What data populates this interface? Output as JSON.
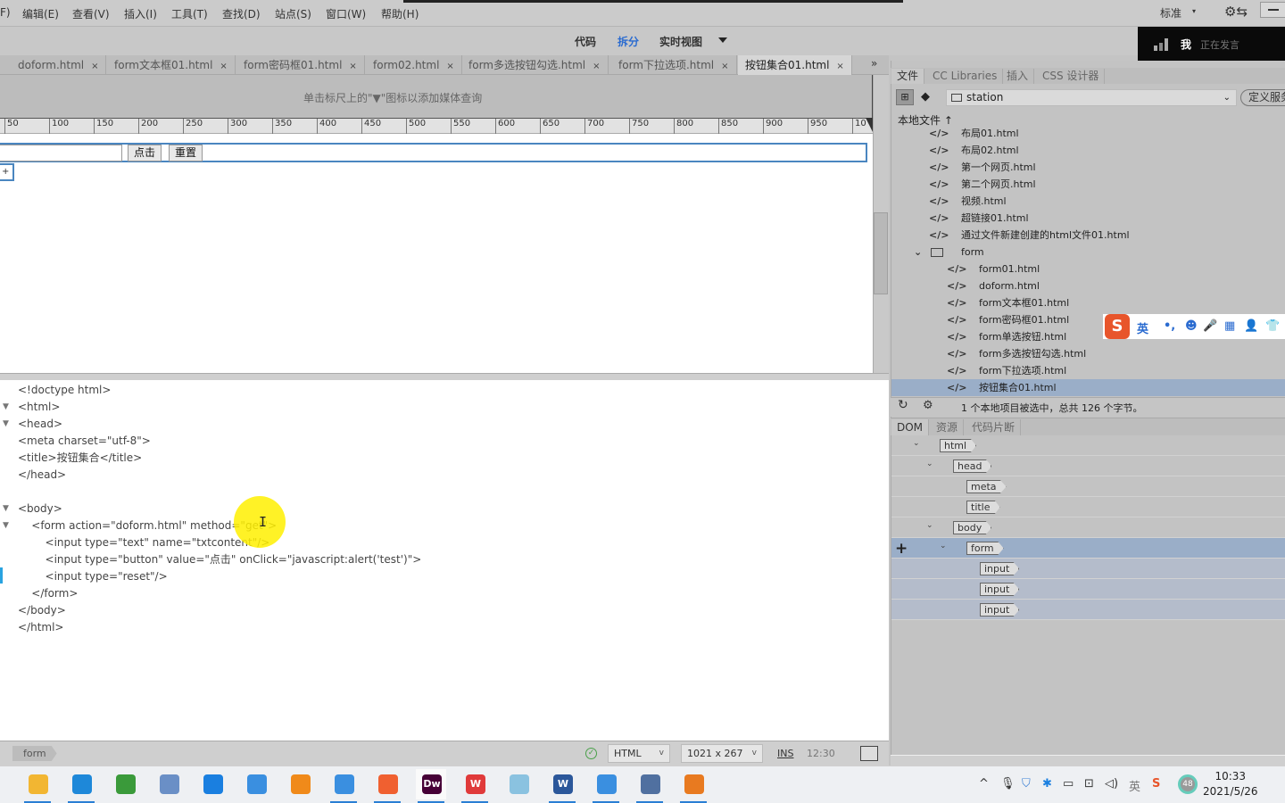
{
  "menu": {
    "items": [
      "F)",
      "编辑(E)",
      "查看(V)",
      "插入(I)",
      "工具(T)",
      "查找(D)",
      "站点(S)",
      "窗口(W)",
      "帮助(H)"
    ],
    "workspace": "标准",
    "workspace_arrow": "▾",
    "settings_icon": "⚙⇆"
  },
  "viewbar": {
    "code": "代码",
    "split": "拆分",
    "live": "实时视图",
    "active": "split"
  },
  "speaking": {
    "me": "我",
    "status": "正在发言"
  },
  "tabs": [
    {
      "label": "doform.html",
      "active": false
    },
    {
      "label": "form文本框01.html",
      "active": false
    },
    {
      "label": "form密码框01.html",
      "active": false
    },
    {
      "label": "form02.html",
      "active": false
    },
    {
      "label": "form多选按钮勾选.html",
      "active": false
    },
    {
      "label": "form下拉选项.html",
      "active": false
    },
    {
      "label": "按钮集合01.html",
      "active": true
    }
  ],
  "tab_close": "×",
  "tab_overflow": "»",
  "design": {
    "media_query_hint": "单击标尺上的\"▼\"图标以添加媒体查询",
    "ruler_ticks": [
      "50",
      "100",
      "150",
      "200",
      "250",
      "300",
      "350",
      "400",
      "450",
      "500",
      "550",
      "600",
      "650",
      "700",
      "750",
      "800",
      "850",
      "900",
      "950",
      "10"
    ],
    "button_label": "点击",
    "reset_label": "重置",
    "plus": "+"
  },
  "code_lines": [
    {
      "text": "<!doctype html>",
      "fold": false
    },
    {
      "text": "<html>",
      "fold": true
    },
    {
      "text": "<head>",
      "fold": true
    },
    {
      "text": "<meta charset=\"utf-8\">",
      "fold": false
    },
    {
      "text": "<title>按钮集合</title>",
      "fold": false
    },
    {
      "text": "</head>",
      "fold": false
    },
    {
      "text": "",
      "fold": false
    },
    {
      "text": "<body>",
      "fold": true
    },
    {
      "text": "    <form action=\"doform.html\" method=\"get\">",
      "fold": true
    },
    {
      "text": "        <input type=\"text\" name=\"txtcontent\"/>",
      "fold": false
    },
    {
      "text": "        <input type=\"button\" value=\"点击\" onClick=\"javascript:alert('test')\">",
      "fold": false
    },
    {
      "text": "        <input type=\"reset\"/>",
      "fold": false
    },
    {
      "text": "    </form>",
      "fold": false
    },
    {
      "text": "</body>",
      "fold": false
    },
    {
      "text": "</html>",
      "fold": false
    }
  ],
  "statusbar": {
    "breadcrumb": "form",
    "ok_icon": "✓",
    "doc_type": "HTML",
    "window_size": "1021 x 267",
    "insert_mode": "INS",
    "cursor_pos": "12:30"
  },
  "files_panel": {
    "tabs": [
      "文件",
      "CC Libraries",
      "插入",
      "CSS 设计器"
    ],
    "site": "station",
    "define_server": "定义服务",
    "local_files": "本地文件 ↑",
    "items": [
      {
        "name": "布局01.html",
        "type": "file",
        "level": 1
      },
      {
        "name": "布局02.html",
        "type": "file",
        "level": 1
      },
      {
        "name": "第一个网页.html",
        "type": "file",
        "level": 1
      },
      {
        "name": "第二个网页.html",
        "type": "file",
        "level": 1
      },
      {
        "name": "视频.html",
        "type": "file",
        "level": 1
      },
      {
        "name": "超链接01.html",
        "type": "file",
        "level": 1
      },
      {
        "name": "通过文件新建创建的html文件01.html",
        "type": "file",
        "level": 1
      },
      {
        "name": "form",
        "type": "folder",
        "level": 1
      },
      {
        "name": "form01.html",
        "type": "file",
        "level": 2
      },
      {
        "name": "doform.html",
        "type": "file",
        "level": 2
      },
      {
        "name": "form文本框01.html",
        "type": "file",
        "level": 2
      },
      {
        "name": "form密码框01.html",
        "type": "file",
        "level": 2
      },
      {
        "name": "form单选按钮.html",
        "type": "file",
        "level": 2
      },
      {
        "name": "form多选按钮勾选.html",
        "type": "file",
        "level": 2
      },
      {
        "name": "form下拉选项.html",
        "type": "file",
        "level": 2
      },
      {
        "name": "按钮集合01.html",
        "type": "file",
        "level": 2,
        "selected": true
      }
    ],
    "status": "1 个本地项目被选中，总共 126 个字节。"
  },
  "ime": {
    "logo": "S",
    "lang": "英",
    "punct": "•,",
    "emoji": "☻",
    "mic": "🎤",
    "keyboard": "▦",
    "user": "👤",
    "skin": "👕"
  },
  "dom_panel": {
    "tabs": [
      "DOM",
      "资源",
      "代码片断"
    ],
    "nodes": [
      {
        "tag": "html",
        "depth": 0,
        "expanded": true
      },
      {
        "tag": "head",
        "depth": 1,
        "expanded": true
      },
      {
        "tag": "meta",
        "depth": 2,
        "expanded": null
      },
      {
        "tag": "title",
        "depth": 2,
        "expanded": null
      },
      {
        "tag": "body",
        "depth": 1,
        "expanded": true
      },
      {
        "tag": "form",
        "depth": 2,
        "expanded": true,
        "selected": true
      },
      {
        "tag": "input",
        "depth": 3,
        "expanded": null,
        "child_of_selected": true
      },
      {
        "tag": "input",
        "depth": 3,
        "expanded": null,
        "child_of_selected": true
      },
      {
        "tag": "input",
        "depth": 3,
        "expanded": null,
        "child_of_selected": true
      }
    ],
    "add_icon": "+"
  },
  "taskbar": {
    "apps": [
      {
        "name": "file-explorer",
        "color": "#f2b632",
        "active": true
      },
      {
        "name": "edge",
        "color": "#1e88d9",
        "active": true
      },
      {
        "name": "app-3",
        "color": "#3a9a3a",
        "active": false
      },
      {
        "name": "app-4",
        "color": "#6a8fc6",
        "active": false
      },
      {
        "name": "app-5",
        "color": "#1a7fe0",
        "active": false
      },
      {
        "name": "app-6",
        "color": "#3a8fe0",
        "active": false
      },
      {
        "name": "search-app",
        "color": "#f08a1a",
        "active": false
      },
      {
        "name": "app-8",
        "color": "#3a8fe0",
        "active": true
      },
      {
        "name": "app-9",
        "color": "#f06030",
        "active": true
      },
      {
        "name": "dreamweaver",
        "color": "#470137",
        "label": "Dw",
        "active": true
      },
      {
        "name": "wps",
        "color": "#e03a3a",
        "label": "W",
        "active": true
      },
      {
        "name": "notepad",
        "color": "#8ac2e0",
        "active": false
      },
      {
        "name": "word",
        "color": "#2b579a",
        "label": "W",
        "active": true
      },
      {
        "name": "app-14",
        "color": "#3a8fe0",
        "active": true
      },
      {
        "name": "app-15",
        "color": "#5070a0",
        "active": true
      },
      {
        "name": "app-16",
        "color": "#e87a20",
        "active": true
      }
    ],
    "tray": {
      "chevron": "^",
      "ime_lang": "英",
      "battery_pct": "48",
      "time": "10:33",
      "date": "2021/5/26"
    }
  }
}
